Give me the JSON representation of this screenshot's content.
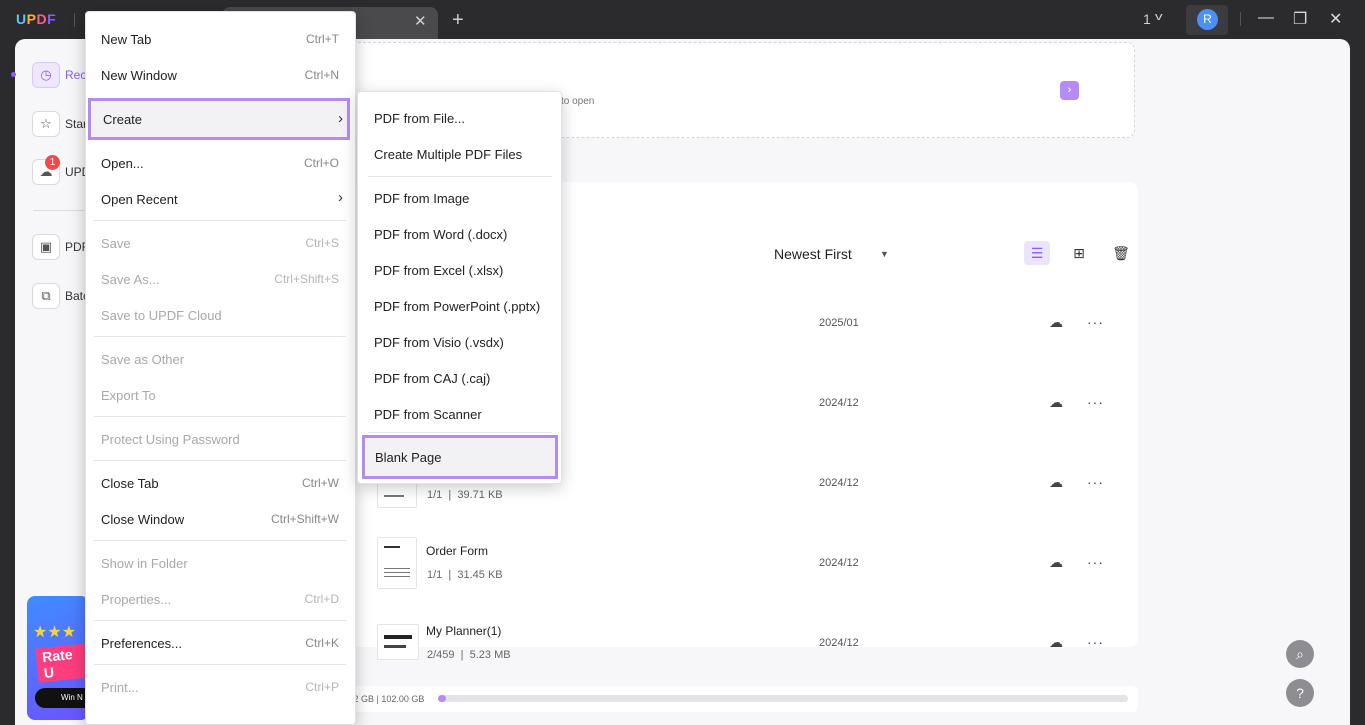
{
  "titlebar": {
    "logo": {
      "u": "U",
      "p": "P",
      "d": "D",
      "f": "F"
    },
    "tab_close": "✕",
    "tab_add": "+",
    "count": "1",
    "avatar_letter": "R",
    "minimize": "—",
    "restore": "❐",
    "close": "✕"
  },
  "sidebar": {
    "items": [
      {
        "label": "Rece",
        "icon": "clock-icon"
      },
      {
        "label": "Star",
        "icon": "star-icon"
      },
      {
        "label": "UPD",
        "icon": "cloud-icon"
      },
      {
        "label": "PDF",
        "icon": "briefcase-icon"
      },
      {
        "label": "Batc",
        "icon": "copy-icon"
      }
    ],
    "cloud_badge": "1",
    "banner": {
      "stars": "★★★",
      "text": "Rate U",
      "button": "Win N"
    }
  },
  "dropzone": {
    "hint": "to open",
    "arrow": "›"
  },
  "toolbar": {
    "sort_label": "Newest First",
    "sort_caret": "▼"
  },
  "files": [
    {
      "name": "",
      "meta_pages": "",
      "meta_size": "",
      "date": "2025/01"
    },
    {
      "name": "",
      "meta_pages": "",
      "meta_size": "",
      "date": "2024/12"
    },
    {
      "name": "",
      "meta_pages": "1/1",
      "meta_size": "39.71 KB",
      "date": "2024/12"
    },
    {
      "name": "Order Form",
      "meta_pages": "1/1",
      "meta_size": "31.45 KB",
      "date": "2024/12"
    },
    {
      "name": "My Planner(1)",
      "meta_pages": "2/459",
      "meta_size": "5.23 MB",
      "date": "2024/12"
    }
  ],
  "storage": {
    "text": "1.22 GB | 102.00 GB",
    "used_fraction": 0.012
  },
  "file_menu": {
    "new_tab": {
      "label": "New Tab",
      "shortcut": "Ctrl+T"
    },
    "new_window": {
      "label": "New Window",
      "shortcut": "Ctrl+N"
    },
    "create": {
      "label": "Create"
    },
    "open": {
      "label": "Open...",
      "shortcut": "Ctrl+O"
    },
    "open_recent": {
      "label": "Open Recent"
    },
    "save": {
      "label": "Save",
      "shortcut": "Ctrl+S"
    },
    "save_as": {
      "label": "Save As...",
      "shortcut": "Ctrl+Shift+S"
    },
    "save_cloud": {
      "label": "Save to UPDF Cloud"
    },
    "save_other": {
      "label": "Save as Other"
    },
    "export_to": {
      "label": "Export To"
    },
    "protect": {
      "label": "Protect Using Password"
    },
    "close_tab": {
      "label": "Close Tab",
      "shortcut": "Ctrl+W"
    },
    "close_window": {
      "label": "Close Window",
      "shortcut": "Ctrl+Shift+W"
    },
    "show_folder": {
      "label": "Show in Folder"
    },
    "properties": {
      "label": "Properties...",
      "shortcut": "Ctrl+D"
    },
    "preferences": {
      "label": "Preferences...",
      "shortcut": "Ctrl+K"
    },
    "print": {
      "label": "Print...",
      "shortcut": "Ctrl+P"
    },
    "arrow": "›"
  },
  "create_submenu": {
    "items": [
      "PDF from File...",
      "Create Multiple PDF Files",
      "PDF from Image",
      "PDF from Word (.docx)",
      "PDF from Excel (.xlsx)",
      "PDF from PowerPoint (.pptx)",
      "PDF from Visio (.vsdx)",
      "PDF from CAJ (.caj)",
      "PDF from Scanner",
      "Blank Page"
    ]
  },
  "help": {
    "search": "⌕",
    "question": "?"
  }
}
